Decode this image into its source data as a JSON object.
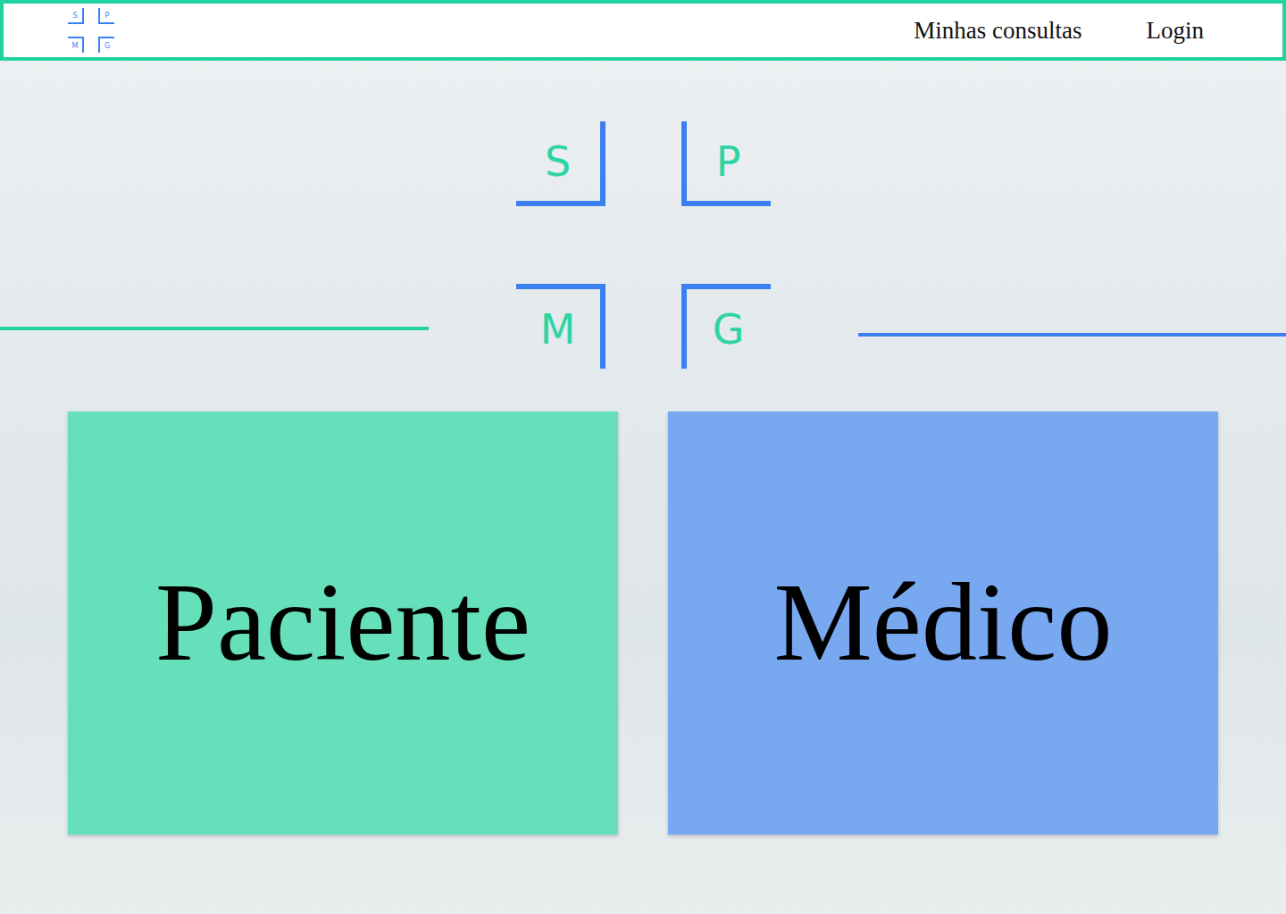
{
  "header": {
    "logo": [
      "S",
      "P",
      "M",
      "G"
    ],
    "nav": [
      "Minhas consultas",
      "Login"
    ]
  },
  "hero": {
    "logo": [
      "S",
      "P",
      "M",
      "G"
    ]
  },
  "cards": [
    {
      "label": "Paciente",
      "color": "#66dfbb"
    },
    {
      "label": "Médico",
      "color": "#78a8f0"
    }
  ]
}
